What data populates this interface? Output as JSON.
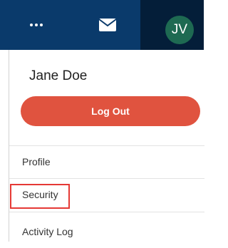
{
  "header": {
    "more_icon": "more-horizontal-icon",
    "mail_icon": "envelope-icon",
    "avatar_initials": "JV",
    "colors": {
      "bar": "#0a3a6b",
      "bar_dark": "#041e39",
      "avatar": "#1e6a52"
    }
  },
  "menu": {
    "user_name": "Jane Doe",
    "logout_label": "Log Out",
    "logout_color": "#e0533f",
    "items": [
      {
        "label": "Profile"
      },
      {
        "label": "Security"
      },
      {
        "label": "Activity Log"
      }
    ],
    "highlight_color": "#e53935"
  }
}
